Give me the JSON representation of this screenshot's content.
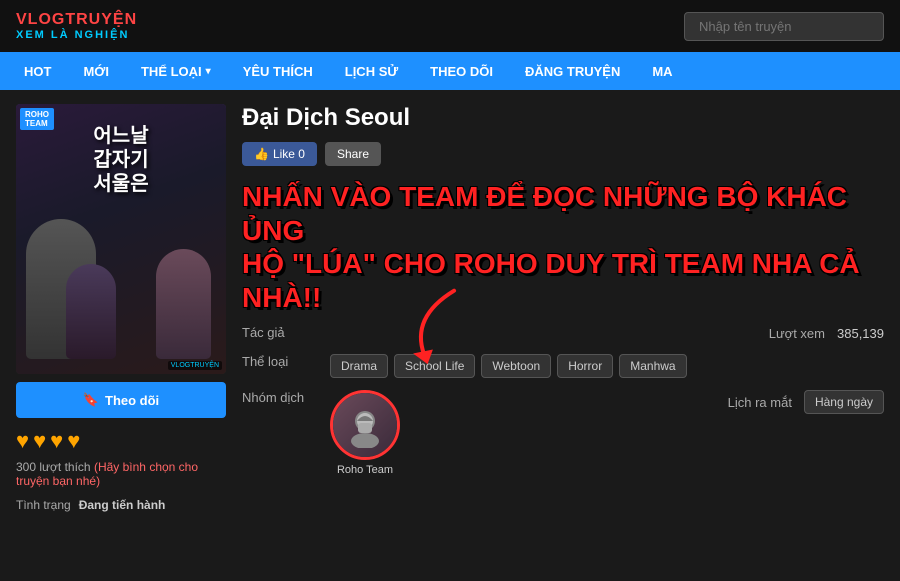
{
  "logo": {
    "main_name": "VLOGTRUYỆN",
    "sub_name": "XEM LÀ NGHIỆN",
    "badge_roho": "ROHO",
    "badge_team": "TEAM"
  },
  "search": {
    "placeholder": "Nhập tên truyện"
  },
  "navbar": {
    "items": [
      {
        "id": "hot",
        "label": "HOT"
      },
      {
        "id": "moi",
        "label": "MỚI"
      },
      {
        "id": "the-loai",
        "label": "THỂ LOẠI",
        "has_arrow": true
      },
      {
        "id": "yeu-thich",
        "label": "YÊU THÍCH"
      },
      {
        "id": "lich-su",
        "label": "LỊCH SỬ"
      },
      {
        "id": "theo-doi",
        "label": "THEO DÕI"
      },
      {
        "id": "dang-truyen",
        "label": "ĐĂNG TRUYỆN"
      },
      {
        "id": "ma",
        "label": "MA"
      }
    ]
  },
  "manga": {
    "title": "Đại Dịch Seoul",
    "cover_title": "어느날\n갑자기\n서울은",
    "roho_badge": "ROHO\nTEAM",
    "vlogtruyenvn_badge": "VLOGTRUYỆN",
    "follow_btn": "Theo dõi",
    "hearts": [
      "♥",
      "♥",
      "♥",
      "♥"
    ],
    "likes_count": "300 lượt thích",
    "rate_text": "(Hãy bình chọn cho truyện bạn nhé)",
    "status_label": "Tình trạng",
    "status_value": "Đang tiến hành",
    "like_btn": "Like 0",
    "share_btn": "Share",
    "promo_text": "NHẤN VÀO TEAM ĐỂ ĐỌC NHỮNG BỘ KHÁC ỦNG HỘ \"LÚA\" CHO ROHO DUY TRÌ TEAM NHA CẢ NHÀ!!",
    "info": {
      "author_label": "Tác giả",
      "author_value": "",
      "views_label": "Lượt xem",
      "views_value": "385,139",
      "genre_label": "Thể loại",
      "genres": [
        "Drama",
        "School Life",
        "Webtoon",
        "Horror",
        "Manhwa"
      ],
      "group_label": "Nhóm dịch",
      "group_name": "Roho Team",
      "schedule_label": "Lịch ra mắt",
      "schedule_value": "Hàng ngày"
    }
  }
}
